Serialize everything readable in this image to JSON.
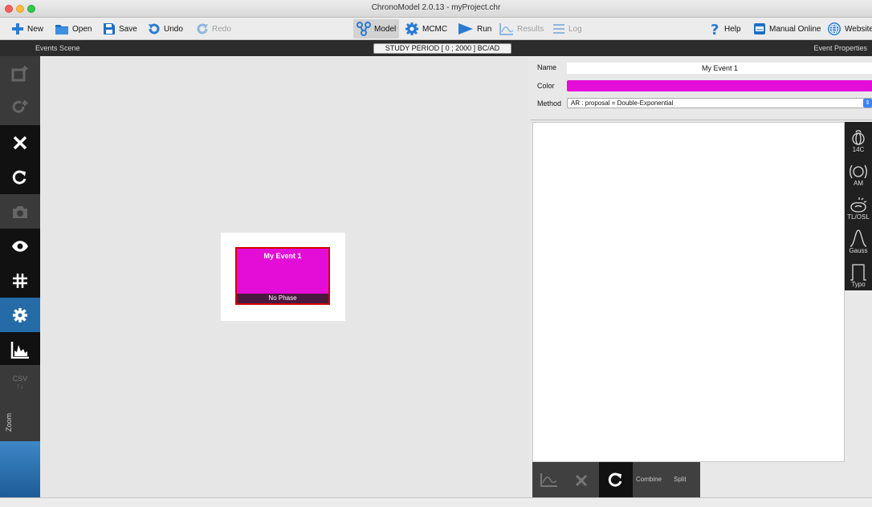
{
  "window": {
    "title": "ChronoModel 2.0.13 - myProject.chr"
  },
  "toolbar": {
    "new": "New",
    "open": "Open",
    "save": "Save",
    "undo": "Undo",
    "redo": "Redo",
    "model": "Model",
    "mcmc": "MCMC",
    "run": "Run",
    "results": "Results",
    "log": "Log",
    "help": "Help",
    "manual": "Manual Online",
    "website": "Website"
  },
  "scene": {
    "events_scene_label": "Events Scene",
    "study_period": "STUDY PERIOD [ 0 ; 2000 ] BC/AD",
    "event_properties_label": "Event Properties"
  },
  "leftbar": {
    "csv_label": "CSV",
    "zoom_label": "Zoom"
  },
  "event": {
    "name": "My Event 1",
    "phase": "No Phase",
    "color": "#e40dd8",
    "border_color": "#d00000"
  },
  "properties": {
    "name_label": "Name",
    "name_value": "My Event 1",
    "color_label": "Color",
    "color_value": "#e40dd8",
    "method_label": "Method",
    "method_value": "AR : proposal = Double-Exponential"
  },
  "datation_tools": [
    {
      "label": "14C",
      "icon": "radiocarbon-icon"
    },
    {
      "label": "AM",
      "icon": "archaeomagnetism-icon"
    },
    {
      "label": "TL/OSL",
      "icon": "tl-osl-icon"
    },
    {
      "label": "Gauss",
      "icon": "gauss-icon"
    },
    {
      "label": "Typo",
      "icon": "typo-icon"
    }
  ],
  "bottom_tools": {
    "combine": "Combine",
    "split": "Split"
  }
}
